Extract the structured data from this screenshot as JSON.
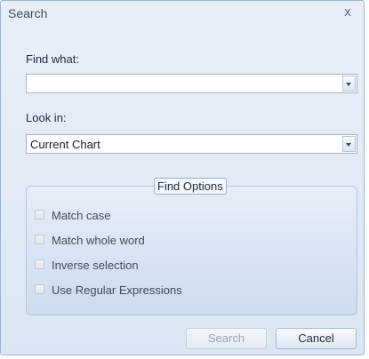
{
  "dialog": {
    "title": "Search",
    "close_glyph": "x"
  },
  "find_what": {
    "label": "Find what:",
    "value": ""
  },
  "look_in": {
    "label": "Look in:",
    "value": "Current Chart"
  },
  "find_options": {
    "legend": "Find Options",
    "items": [
      {
        "label": "Match case",
        "checked": false
      },
      {
        "label": "Match whole word",
        "checked": false
      },
      {
        "label": "Inverse selection",
        "checked": false
      },
      {
        "label": "Use Regular Expressions",
        "checked": false
      }
    ]
  },
  "buttons": {
    "search": "Search",
    "cancel": "Cancel"
  },
  "icons": {
    "close": "close-icon",
    "dropdown": "chevron-down-icon",
    "checkbox": "checkbox-icon"
  },
  "colors": {
    "dialog_background": "#dbe6f4",
    "border": "#9db3cf",
    "disabled_text": "#9aa5b3"
  }
}
